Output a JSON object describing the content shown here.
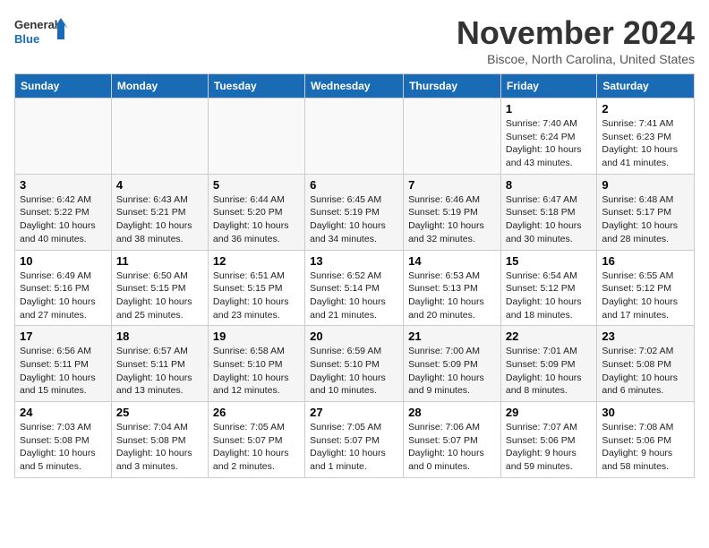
{
  "logo": {
    "line1": "General",
    "line2": "Blue"
  },
  "title": "November 2024",
  "location": "Biscoe, North Carolina, United States",
  "weekdays": [
    "Sunday",
    "Monday",
    "Tuesday",
    "Wednesday",
    "Thursday",
    "Friday",
    "Saturday"
  ],
  "weeks": [
    [
      {
        "day": "",
        "info": ""
      },
      {
        "day": "",
        "info": ""
      },
      {
        "day": "",
        "info": ""
      },
      {
        "day": "",
        "info": ""
      },
      {
        "day": "",
        "info": ""
      },
      {
        "day": "1",
        "info": "Sunrise: 7:40 AM\nSunset: 6:24 PM\nDaylight: 10 hours and 43 minutes."
      },
      {
        "day": "2",
        "info": "Sunrise: 7:41 AM\nSunset: 6:23 PM\nDaylight: 10 hours and 41 minutes."
      }
    ],
    [
      {
        "day": "3",
        "info": "Sunrise: 6:42 AM\nSunset: 5:22 PM\nDaylight: 10 hours and 40 minutes."
      },
      {
        "day": "4",
        "info": "Sunrise: 6:43 AM\nSunset: 5:21 PM\nDaylight: 10 hours and 38 minutes."
      },
      {
        "day": "5",
        "info": "Sunrise: 6:44 AM\nSunset: 5:20 PM\nDaylight: 10 hours and 36 minutes."
      },
      {
        "day": "6",
        "info": "Sunrise: 6:45 AM\nSunset: 5:19 PM\nDaylight: 10 hours and 34 minutes."
      },
      {
        "day": "7",
        "info": "Sunrise: 6:46 AM\nSunset: 5:19 PM\nDaylight: 10 hours and 32 minutes."
      },
      {
        "day": "8",
        "info": "Sunrise: 6:47 AM\nSunset: 5:18 PM\nDaylight: 10 hours and 30 minutes."
      },
      {
        "day": "9",
        "info": "Sunrise: 6:48 AM\nSunset: 5:17 PM\nDaylight: 10 hours and 28 minutes."
      }
    ],
    [
      {
        "day": "10",
        "info": "Sunrise: 6:49 AM\nSunset: 5:16 PM\nDaylight: 10 hours and 27 minutes."
      },
      {
        "day": "11",
        "info": "Sunrise: 6:50 AM\nSunset: 5:15 PM\nDaylight: 10 hours and 25 minutes."
      },
      {
        "day": "12",
        "info": "Sunrise: 6:51 AM\nSunset: 5:15 PM\nDaylight: 10 hours and 23 minutes."
      },
      {
        "day": "13",
        "info": "Sunrise: 6:52 AM\nSunset: 5:14 PM\nDaylight: 10 hours and 21 minutes."
      },
      {
        "day": "14",
        "info": "Sunrise: 6:53 AM\nSunset: 5:13 PM\nDaylight: 10 hours and 20 minutes."
      },
      {
        "day": "15",
        "info": "Sunrise: 6:54 AM\nSunset: 5:12 PM\nDaylight: 10 hours and 18 minutes."
      },
      {
        "day": "16",
        "info": "Sunrise: 6:55 AM\nSunset: 5:12 PM\nDaylight: 10 hours and 17 minutes."
      }
    ],
    [
      {
        "day": "17",
        "info": "Sunrise: 6:56 AM\nSunset: 5:11 PM\nDaylight: 10 hours and 15 minutes."
      },
      {
        "day": "18",
        "info": "Sunrise: 6:57 AM\nSunset: 5:11 PM\nDaylight: 10 hours and 13 minutes."
      },
      {
        "day": "19",
        "info": "Sunrise: 6:58 AM\nSunset: 5:10 PM\nDaylight: 10 hours and 12 minutes."
      },
      {
        "day": "20",
        "info": "Sunrise: 6:59 AM\nSunset: 5:10 PM\nDaylight: 10 hours and 10 minutes."
      },
      {
        "day": "21",
        "info": "Sunrise: 7:00 AM\nSunset: 5:09 PM\nDaylight: 10 hours and 9 minutes."
      },
      {
        "day": "22",
        "info": "Sunrise: 7:01 AM\nSunset: 5:09 PM\nDaylight: 10 hours and 8 minutes."
      },
      {
        "day": "23",
        "info": "Sunrise: 7:02 AM\nSunset: 5:08 PM\nDaylight: 10 hours and 6 minutes."
      }
    ],
    [
      {
        "day": "24",
        "info": "Sunrise: 7:03 AM\nSunset: 5:08 PM\nDaylight: 10 hours and 5 minutes."
      },
      {
        "day": "25",
        "info": "Sunrise: 7:04 AM\nSunset: 5:08 PM\nDaylight: 10 hours and 3 minutes."
      },
      {
        "day": "26",
        "info": "Sunrise: 7:05 AM\nSunset: 5:07 PM\nDaylight: 10 hours and 2 minutes."
      },
      {
        "day": "27",
        "info": "Sunrise: 7:05 AM\nSunset: 5:07 PM\nDaylight: 10 hours and 1 minute."
      },
      {
        "day": "28",
        "info": "Sunrise: 7:06 AM\nSunset: 5:07 PM\nDaylight: 10 hours and 0 minutes."
      },
      {
        "day": "29",
        "info": "Sunrise: 7:07 AM\nSunset: 5:06 PM\nDaylight: 9 hours and 59 minutes."
      },
      {
        "day": "30",
        "info": "Sunrise: 7:08 AM\nSunset: 5:06 PM\nDaylight: 9 hours and 58 minutes."
      }
    ]
  ]
}
